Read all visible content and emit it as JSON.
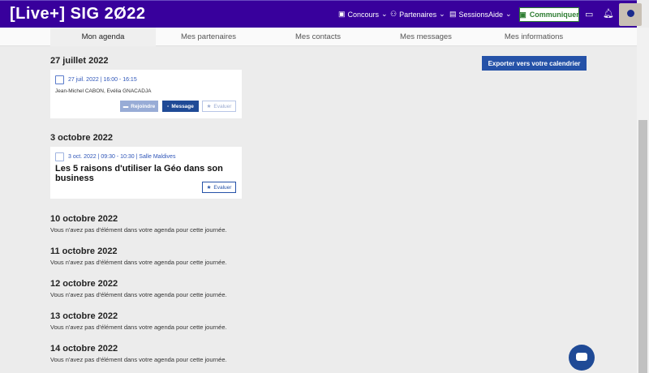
{
  "header": {
    "logo": "[Live+] SIG 2Ø22",
    "nav": [
      {
        "label": "Concours",
        "icon": "trophy-icon"
      },
      {
        "label": "Partenaires",
        "icon": "partners-icon"
      },
      {
        "label": "Sessions",
        "icon": "sessions-icon"
      },
      {
        "label": "Aide"
      }
    ],
    "communicate": "Communiquer"
  },
  "tabs": [
    "Mon agenda",
    "Mes partenaires",
    "Mes contacts",
    "Mes messages",
    "Mes informations"
  ],
  "export": "Exporter vers votre calendrier",
  "days": [
    {
      "date": "27 juillet 2022",
      "card": {
        "meta": "27 juil. 2022 | 16:00 - 16:15",
        "people": "Jean-Michel CABON, Evélia GNACADJA",
        "join": "Rejoindre",
        "message": "Message",
        "rate": "Evaluer"
      }
    },
    {
      "date": "3 octobre 2022",
      "card": {
        "meta": "3 oct. 2022 | 09:30 - 10:30 | Salle Maldives",
        "title": "Les 5 raisons d'utiliser la Géo dans son business",
        "rate": "Evaluer"
      }
    },
    {
      "date": "10 octobre 2022"
    },
    {
      "date": "11 octobre 2022"
    },
    {
      "date": "12 octobre 2022"
    },
    {
      "date": "13 octobre 2022"
    },
    {
      "date": "14 octobre 2022"
    }
  ],
  "empty_text": "Vous n'avez pas d'élément dans votre agenda pour cette journée.",
  "colors": {
    "header": "#38009c",
    "primary": "#2552a8"
  }
}
